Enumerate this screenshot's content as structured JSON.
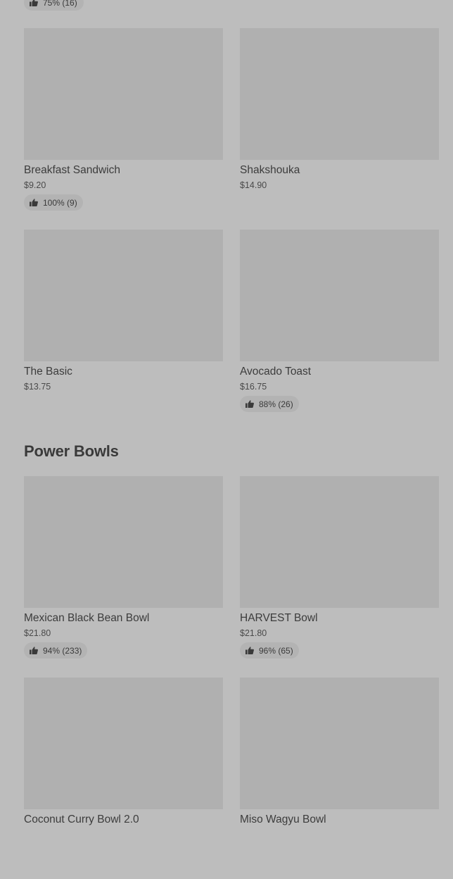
{
  "top_partial_rating": "75% (16)",
  "section_a": {
    "items": [
      {
        "name": "Breakfast Sandwich",
        "price": "$9.20",
        "rating": "100% (9)"
      },
      {
        "name": "Shakshouka",
        "price": "$14.90",
        "rating": ""
      },
      {
        "name": "The Basic",
        "price": "$13.75",
        "rating": ""
      },
      {
        "name": "Avocado Toast",
        "price": "$16.75",
        "rating": "88% (26)"
      }
    ]
  },
  "section_b": {
    "title": "Power Bowls",
    "items": [
      {
        "name": "Mexican Black Bean Bowl",
        "price": "$21.80",
        "rating": "94% (233)"
      },
      {
        "name": "HARVEST Bowl",
        "price": "$21.80",
        "rating": "96% (65)"
      },
      {
        "name": "Coconut Curry Bowl 2.0",
        "price": "",
        "rating": ""
      },
      {
        "name": "Miso Wagyu Bowl",
        "price": "",
        "rating": ""
      }
    ]
  },
  "icons": {
    "rating": "thumbs-up-icon"
  },
  "colors": {
    "background": "#bdbdbd",
    "image_placeholder": "#b0b0b0",
    "badge": "#b3b3b3",
    "text": "#3a3a3a"
  }
}
